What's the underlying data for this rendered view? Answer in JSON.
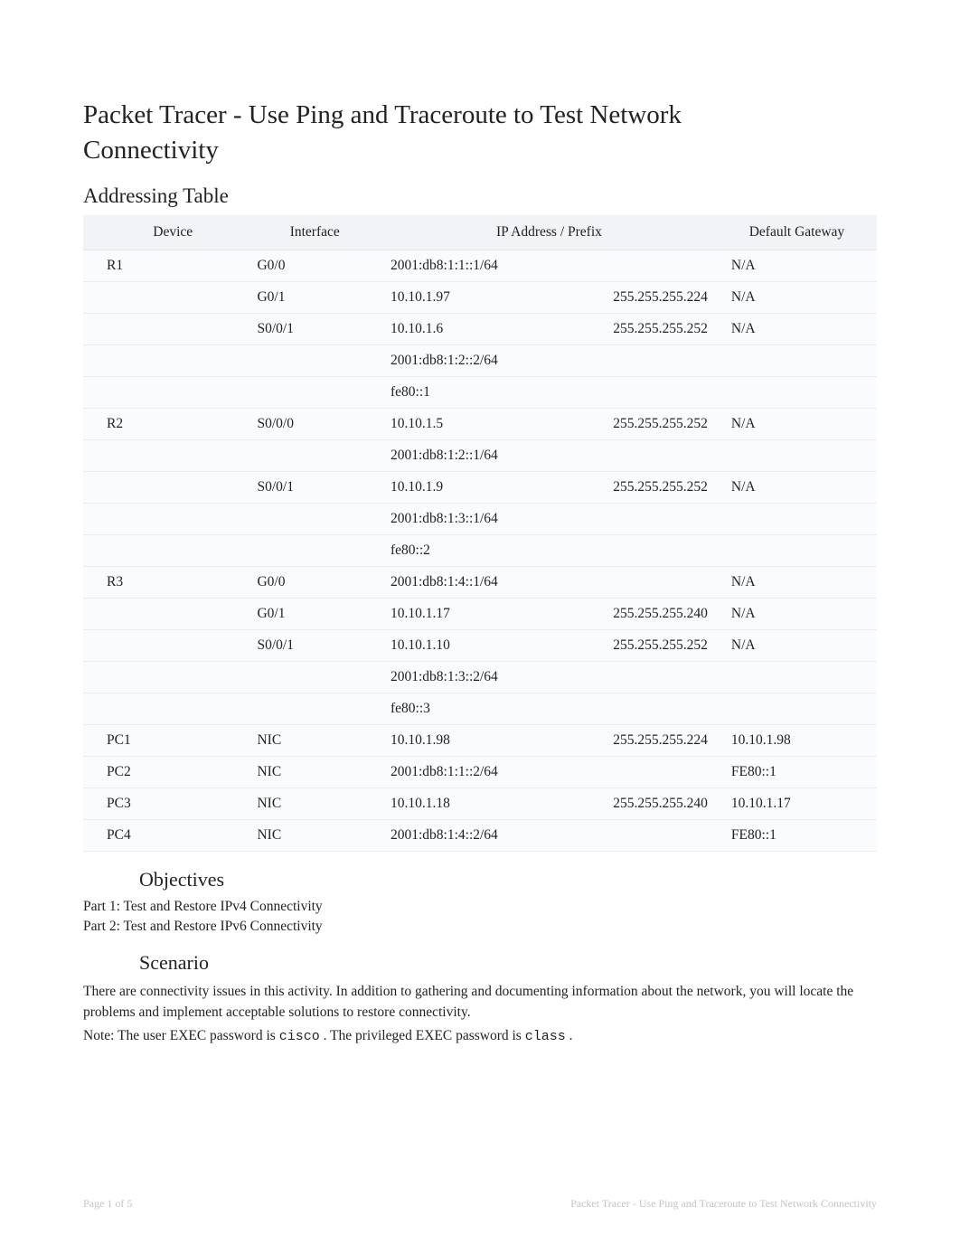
{
  "title_line1": "Packet Tracer - Use Ping and Traceroute to Test Network",
  "title_line2": "Connectivity",
  "addressing_heading": "Addressing Table",
  "table": {
    "headers": {
      "device": "Device",
      "interface": "Interface",
      "ip": "IP Address / Prefix",
      "gateway": "Default Gateway"
    },
    "rows": [
      {
        "device": "R1",
        "interface": "G0/0",
        "ip": "2001:db8:1:1::1/64",
        "mask": "",
        "gateway": "N/A"
      },
      {
        "device": "",
        "interface": "G0/1",
        "ip": "10.10.1.97",
        "mask": "255.255.255.224",
        "gateway": "N/A"
      },
      {
        "device": "",
        "interface": "S0/0/1",
        "ip": "10.10.1.6",
        "mask": "255.255.255.252",
        "gateway": "N/A"
      },
      {
        "device": "",
        "interface": "",
        "ip": "2001:db8:1:2::2/64",
        "mask": "",
        "gateway": ""
      },
      {
        "device": "",
        "interface": "",
        "ip": "fe80::1",
        "mask": "",
        "gateway": ""
      },
      {
        "device": "R2",
        "interface": "S0/0/0",
        "ip": "10.10.1.5",
        "mask": "255.255.255.252",
        "gateway": "N/A"
      },
      {
        "device": "",
        "interface": "",
        "ip": "2001:db8:1:2::1/64",
        "mask": "",
        "gateway": ""
      },
      {
        "device": "",
        "interface": "S0/0/1",
        "ip": "10.10.1.9",
        "mask": "255.255.255.252",
        "gateway": "N/A"
      },
      {
        "device": "",
        "interface": "",
        "ip": "2001:db8:1:3::1/64",
        "mask": "",
        "gateway": ""
      },
      {
        "device": "",
        "interface": "",
        "ip": "fe80::2",
        "mask": "",
        "gateway": ""
      },
      {
        "device": "R3",
        "interface": "G0/0",
        "ip": "2001:db8:1:4::1/64",
        "mask": "",
        "gateway": "N/A"
      },
      {
        "device": "",
        "interface": "G0/1",
        "ip": "10.10.1.17",
        "mask": "255.255.255.240",
        "gateway": "N/A"
      },
      {
        "device": "",
        "interface": "S0/0/1",
        "ip": "10.10.1.10",
        "mask": "255.255.255.252",
        "gateway": "N/A"
      },
      {
        "device": "",
        "interface": "",
        "ip": "2001:db8:1:3::2/64",
        "mask": "",
        "gateway": ""
      },
      {
        "device": "",
        "interface": "",
        "ip": "fe80::3",
        "mask": "",
        "gateway": ""
      },
      {
        "device": "PC1",
        "interface": "NIC",
        "ip": "10.10.1.98",
        "mask": "255.255.255.224",
        "gateway": "10.10.1.98"
      },
      {
        "device": "PC2",
        "interface": "NIC",
        "ip": "2001:db8:1:1::2/64",
        "mask": "",
        "gateway": "FE80::1"
      },
      {
        "device": "PC3",
        "interface": "NIC",
        "ip": "10.10.1.18",
        "mask": "255.255.255.240",
        "gateway": "10.10.1.17"
      },
      {
        "device": "PC4",
        "interface": "NIC",
        "ip": "2001:db8:1:4::2/64",
        "mask": "",
        "gateway": "FE80::1"
      }
    ]
  },
  "objectives_heading": "Objectives",
  "objectives": [
    "Part 1: Test and Restore IPv4 Connectivity",
    "Part 2: Test and Restore IPv6 Connectivity"
  ],
  "scenario_heading": "Scenario",
  "scenario_text": "There are connectivity issues in this activity. In addition to gathering and documenting information about the network, you will locate the problems and implement acceptable solutions to restore connectivity.",
  "note_prefix": "Note:  The user EXEC password is ",
  "note_pw1": "cisco",
  "note_mid": " . The privileged EXEC password is ",
  "note_pw2": "class",
  "note_suffix": " .",
  "footer_left_prefix": "Page ",
  "footer_page_current": "1",
  "footer_page_of": " of ",
  "footer_page_total": "5",
  "footer_right": "Packet Tracer - Use Ping and Traceroute to Test Network Connectivity"
}
